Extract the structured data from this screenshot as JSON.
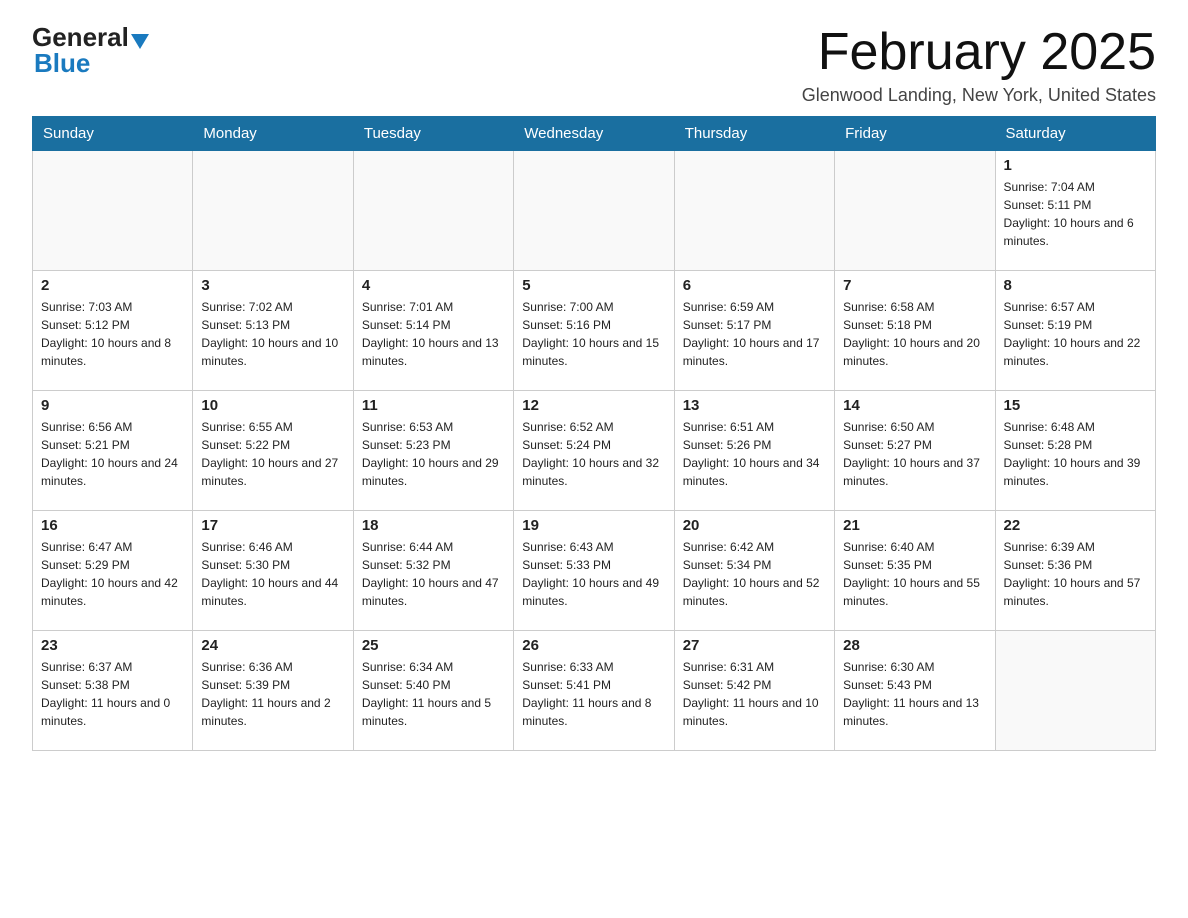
{
  "header": {
    "logo_general": "General",
    "logo_blue": "Blue",
    "month_title": "February 2025",
    "location": "Glenwood Landing, New York, United States"
  },
  "weekdays": [
    "Sunday",
    "Monday",
    "Tuesday",
    "Wednesday",
    "Thursday",
    "Friday",
    "Saturday"
  ],
  "weeks": [
    [
      {
        "day": "",
        "sunrise": "",
        "sunset": "",
        "daylight": ""
      },
      {
        "day": "",
        "sunrise": "",
        "sunset": "",
        "daylight": ""
      },
      {
        "day": "",
        "sunrise": "",
        "sunset": "",
        "daylight": ""
      },
      {
        "day": "",
        "sunrise": "",
        "sunset": "",
        "daylight": ""
      },
      {
        "day": "",
        "sunrise": "",
        "sunset": "",
        "daylight": ""
      },
      {
        "day": "",
        "sunrise": "",
        "sunset": "",
        "daylight": ""
      },
      {
        "day": "1",
        "sunrise": "Sunrise: 7:04 AM",
        "sunset": "Sunset: 5:11 PM",
        "daylight": "Daylight: 10 hours and 6 minutes."
      }
    ],
    [
      {
        "day": "2",
        "sunrise": "Sunrise: 7:03 AM",
        "sunset": "Sunset: 5:12 PM",
        "daylight": "Daylight: 10 hours and 8 minutes."
      },
      {
        "day": "3",
        "sunrise": "Sunrise: 7:02 AM",
        "sunset": "Sunset: 5:13 PM",
        "daylight": "Daylight: 10 hours and 10 minutes."
      },
      {
        "day": "4",
        "sunrise": "Sunrise: 7:01 AM",
        "sunset": "Sunset: 5:14 PM",
        "daylight": "Daylight: 10 hours and 13 minutes."
      },
      {
        "day": "5",
        "sunrise": "Sunrise: 7:00 AM",
        "sunset": "Sunset: 5:16 PM",
        "daylight": "Daylight: 10 hours and 15 minutes."
      },
      {
        "day": "6",
        "sunrise": "Sunrise: 6:59 AM",
        "sunset": "Sunset: 5:17 PM",
        "daylight": "Daylight: 10 hours and 17 minutes."
      },
      {
        "day": "7",
        "sunrise": "Sunrise: 6:58 AM",
        "sunset": "Sunset: 5:18 PM",
        "daylight": "Daylight: 10 hours and 20 minutes."
      },
      {
        "day": "8",
        "sunrise": "Sunrise: 6:57 AM",
        "sunset": "Sunset: 5:19 PM",
        "daylight": "Daylight: 10 hours and 22 minutes."
      }
    ],
    [
      {
        "day": "9",
        "sunrise": "Sunrise: 6:56 AM",
        "sunset": "Sunset: 5:21 PM",
        "daylight": "Daylight: 10 hours and 24 minutes."
      },
      {
        "day": "10",
        "sunrise": "Sunrise: 6:55 AM",
        "sunset": "Sunset: 5:22 PM",
        "daylight": "Daylight: 10 hours and 27 minutes."
      },
      {
        "day": "11",
        "sunrise": "Sunrise: 6:53 AM",
        "sunset": "Sunset: 5:23 PM",
        "daylight": "Daylight: 10 hours and 29 minutes."
      },
      {
        "day": "12",
        "sunrise": "Sunrise: 6:52 AM",
        "sunset": "Sunset: 5:24 PM",
        "daylight": "Daylight: 10 hours and 32 minutes."
      },
      {
        "day": "13",
        "sunrise": "Sunrise: 6:51 AM",
        "sunset": "Sunset: 5:26 PM",
        "daylight": "Daylight: 10 hours and 34 minutes."
      },
      {
        "day": "14",
        "sunrise": "Sunrise: 6:50 AM",
        "sunset": "Sunset: 5:27 PM",
        "daylight": "Daylight: 10 hours and 37 minutes."
      },
      {
        "day": "15",
        "sunrise": "Sunrise: 6:48 AM",
        "sunset": "Sunset: 5:28 PM",
        "daylight": "Daylight: 10 hours and 39 minutes."
      }
    ],
    [
      {
        "day": "16",
        "sunrise": "Sunrise: 6:47 AM",
        "sunset": "Sunset: 5:29 PM",
        "daylight": "Daylight: 10 hours and 42 minutes."
      },
      {
        "day": "17",
        "sunrise": "Sunrise: 6:46 AM",
        "sunset": "Sunset: 5:30 PM",
        "daylight": "Daylight: 10 hours and 44 minutes."
      },
      {
        "day": "18",
        "sunrise": "Sunrise: 6:44 AM",
        "sunset": "Sunset: 5:32 PM",
        "daylight": "Daylight: 10 hours and 47 minutes."
      },
      {
        "day": "19",
        "sunrise": "Sunrise: 6:43 AM",
        "sunset": "Sunset: 5:33 PM",
        "daylight": "Daylight: 10 hours and 49 minutes."
      },
      {
        "day": "20",
        "sunrise": "Sunrise: 6:42 AM",
        "sunset": "Sunset: 5:34 PM",
        "daylight": "Daylight: 10 hours and 52 minutes."
      },
      {
        "day": "21",
        "sunrise": "Sunrise: 6:40 AM",
        "sunset": "Sunset: 5:35 PM",
        "daylight": "Daylight: 10 hours and 55 minutes."
      },
      {
        "day": "22",
        "sunrise": "Sunrise: 6:39 AM",
        "sunset": "Sunset: 5:36 PM",
        "daylight": "Daylight: 10 hours and 57 minutes."
      }
    ],
    [
      {
        "day": "23",
        "sunrise": "Sunrise: 6:37 AM",
        "sunset": "Sunset: 5:38 PM",
        "daylight": "Daylight: 11 hours and 0 minutes."
      },
      {
        "day": "24",
        "sunrise": "Sunrise: 6:36 AM",
        "sunset": "Sunset: 5:39 PM",
        "daylight": "Daylight: 11 hours and 2 minutes."
      },
      {
        "day": "25",
        "sunrise": "Sunrise: 6:34 AM",
        "sunset": "Sunset: 5:40 PM",
        "daylight": "Daylight: 11 hours and 5 minutes."
      },
      {
        "day": "26",
        "sunrise": "Sunrise: 6:33 AM",
        "sunset": "Sunset: 5:41 PM",
        "daylight": "Daylight: 11 hours and 8 minutes."
      },
      {
        "day": "27",
        "sunrise": "Sunrise: 6:31 AM",
        "sunset": "Sunset: 5:42 PM",
        "daylight": "Daylight: 11 hours and 10 minutes."
      },
      {
        "day": "28",
        "sunrise": "Sunrise: 6:30 AM",
        "sunset": "Sunset: 5:43 PM",
        "daylight": "Daylight: 11 hours and 13 minutes."
      },
      {
        "day": "",
        "sunrise": "",
        "sunset": "",
        "daylight": ""
      }
    ]
  ]
}
